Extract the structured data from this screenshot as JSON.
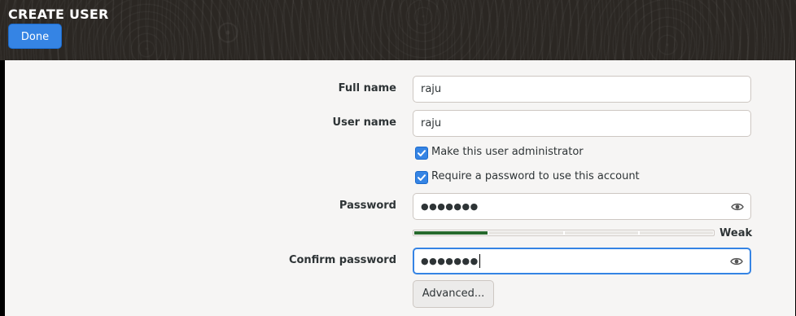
{
  "header": {
    "title": "CREATE USER",
    "done_label": "Done"
  },
  "form": {
    "full_name": {
      "label": "Full name",
      "value": "raju"
    },
    "user_name": {
      "label": "User name",
      "value": "raju"
    },
    "admin_checkbox": {
      "label": "Make this user administrator",
      "checked": true
    },
    "require_password_checkbox": {
      "label": "Require a password to use this account",
      "checked": true
    },
    "password": {
      "label": "Password",
      "masked_value": "●●●●●●●",
      "reveal_icon": "eye-icon"
    },
    "strength": {
      "label": "Weak",
      "level": 0.25,
      "color": "#26692c"
    },
    "confirm_password": {
      "label": "Confirm password",
      "masked_value": "●●●●●●●",
      "reveal_icon": "eye-icon"
    },
    "advanced_label": "Advanced..."
  },
  "colors": {
    "accent": "#3584e4",
    "header_bg": "#2b2723"
  }
}
